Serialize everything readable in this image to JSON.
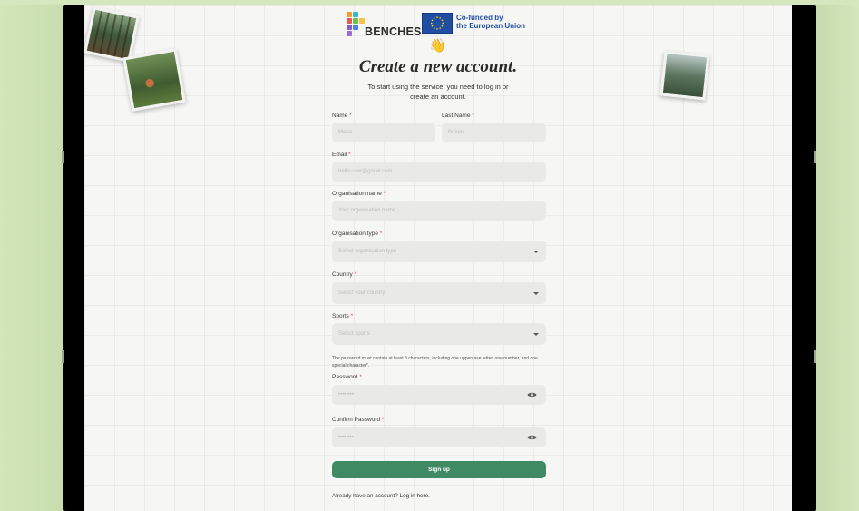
{
  "header": {
    "brand": "BENCHES",
    "eu_line1": "Co-funded by",
    "eu_line2": "the European Union",
    "wave_emoji": "👋"
  },
  "page": {
    "title": "Create a new account.",
    "subtitle_line1": "To start using the service, you need to log in or",
    "subtitle_line2": "create an account."
  },
  "form": {
    "required_mark": "*",
    "name": {
      "label": "Name",
      "placeholder": "Maria"
    },
    "last_name": {
      "label": "Last Name",
      "placeholder": "Brown"
    },
    "email": {
      "label": "Email",
      "placeholder": "hello.user@gmail.com"
    },
    "org_name": {
      "label": "Organisation name",
      "placeholder": "Your organisation name"
    },
    "org_type": {
      "label": "Organisation type",
      "placeholder": "Select organisation type"
    },
    "country": {
      "label": "Country",
      "placeholder": "Select your country"
    },
    "sports": {
      "label": "Sports",
      "placeholder": "Select sports"
    },
    "password_hint": "The password must contain at least 8 characters, including one uppercase letter, one number, and one special character*.",
    "password": {
      "label": "Password",
      "placeholder": "••••••••"
    },
    "confirm_password": {
      "label": "Confirm Password",
      "placeholder": "••••••••"
    },
    "signup_label": "Sign up",
    "login_prompt": "Already have an account?",
    "login_link": "Log in here."
  },
  "colors": {
    "accent": "#3f8a63",
    "background": "#cfe3b4",
    "required": "#d64545",
    "eu_blue": "#1f4ea3"
  },
  "icons": {
    "dropdown": "chevron-down-icon",
    "password_toggle": "eye-icon"
  }
}
